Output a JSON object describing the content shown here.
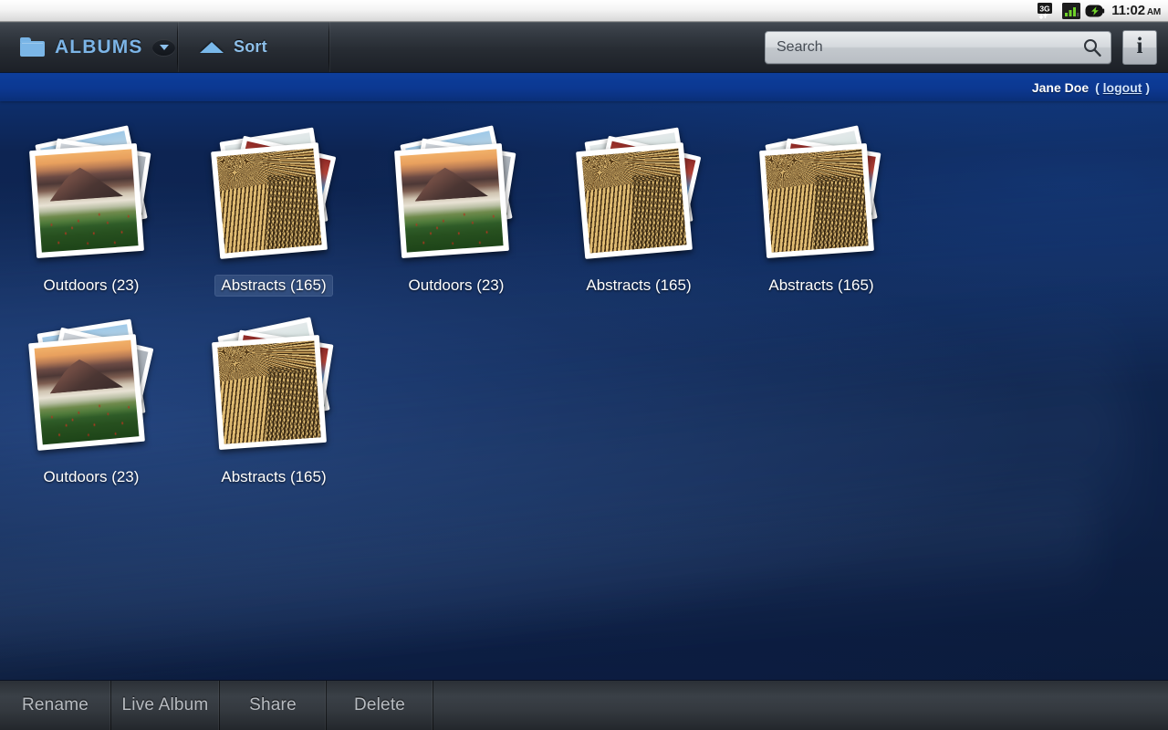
{
  "statusbar": {
    "network_icon": "3g-icon",
    "network_label": "3G",
    "signal_icon": "signal-bars-icon",
    "battery_icon": "battery-charging-icon",
    "time": "11:02",
    "meridiem": "AM"
  },
  "topbar": {
    "albums": {
      "label": "ALBUMS",
      "folder_icon": "folder-icon",
      "dropdown_icon": "chevron-down-icon"
    },
    "sort": {
      "label": "Sort",
      "icon": "sort-up-arrow-icon"
    },
    "search": {
      "placeholder": "Search",
      "value": "",
      "icon": "search-icon"
    },
    "info": {
      "label": "i",
      "icon": "info-icon"
    }
  },
  "userbar": {
    "username": "Jane Doe",
    "logout_open": "(",
    "logout_label": "logout",
    "logout_close": ")"
  },
  "albums": [
    {
      "title": "Outdoors (23)",
      "name": "Outdoors",
      "count": 23,
      "kind": "outdoors",
      "selected": false
    },
    {
      "title": "Abstracts (165)",
      "name": "Abstracts",
      "count": 165,
      "kind": "abstracts",
      "selected": true
    },
    {
      "title": "Outdoors (23)",
      "name": "Outdoors",
      "count": 23,
      "kind": "outdoors",
      "selected": false
    },
    {
      "title": "Abstracts (165)",
      "name": "Abstracts",
      "count": 165,
      "kind": "abstracts",
      "selected": false
    },
    {
      "title": "Abstracts (165)",
      "name": "Abstracts",
      "count": 165,
      "kind": "abstracts",
      "selected": false
    },
    {
      "title": "Outdoors (23)",
      "name": "Outdoors",
      "count": 23,
      "kind": "outdoors",
      "selected": false
    },
    {
      "title": "Abstracts (165)",
      "name": "Abstracts",
      "count": 165,
      "kind": "abstracts",
      "selected": false
    }
  ],
  "bottombar": {
    "buttons": [
      {
        "label": "Rename"
      },
      {
        "label": "Live Album"
      },
      {
        "label": "Share"
      },
      {
        "label": "Delete"
      }
    ]
  },
  "colors": {
    "accent_blue": "#7cb4e6",
    "bg_blue_top": "#0f3d91",
    "bg_blue_bottom": "#0b1a38",
    "userbar_blue": "#0c3891",
    "toolbar_dark": "#353b43",
    "bottombar_text": "#b8bcc1"
  }
}
